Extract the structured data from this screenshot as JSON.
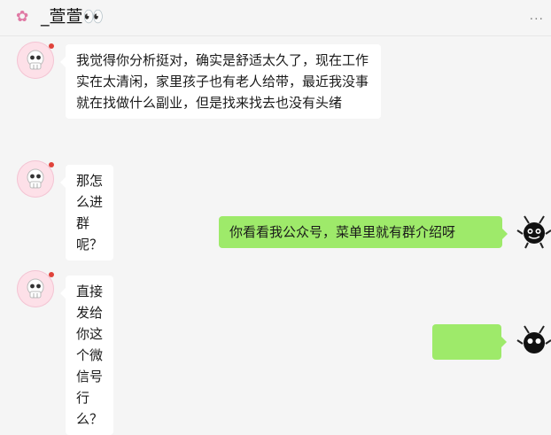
{
  "header": {
    "flower_icon": "flower-icon",
    "title": "_萱萱👀",
    "more_icon": "more-icon"
  },
  "messages": [
    {
      "side": "left",
      "text": "我觉得你分析挺对，确实是舒适太久了，现在工作实在太清闲，家里孩子也有老人给带，最近我没事就在找做什么副业，但是找来找去也没有头绪"
    },
    {
      "side": "left",
      "text": "那怎么进群呢？"
    },
    {
      "side": "right",
      "text": "你看看我公众号，菜单里就有群介绍呀"
    },
    {
      "side": "left",
      "text": "直接发给你这个微信号行么？"
    },
    {
      "side": "right",
      "text": ""
    }
  ],
  "colors": {
    "bubble_self": "#9eea6a",
    "bubble_other": "#ffffff",
    "background": "#f5f5f5",
    "unread_dot": "#e0433b"
  }
}
